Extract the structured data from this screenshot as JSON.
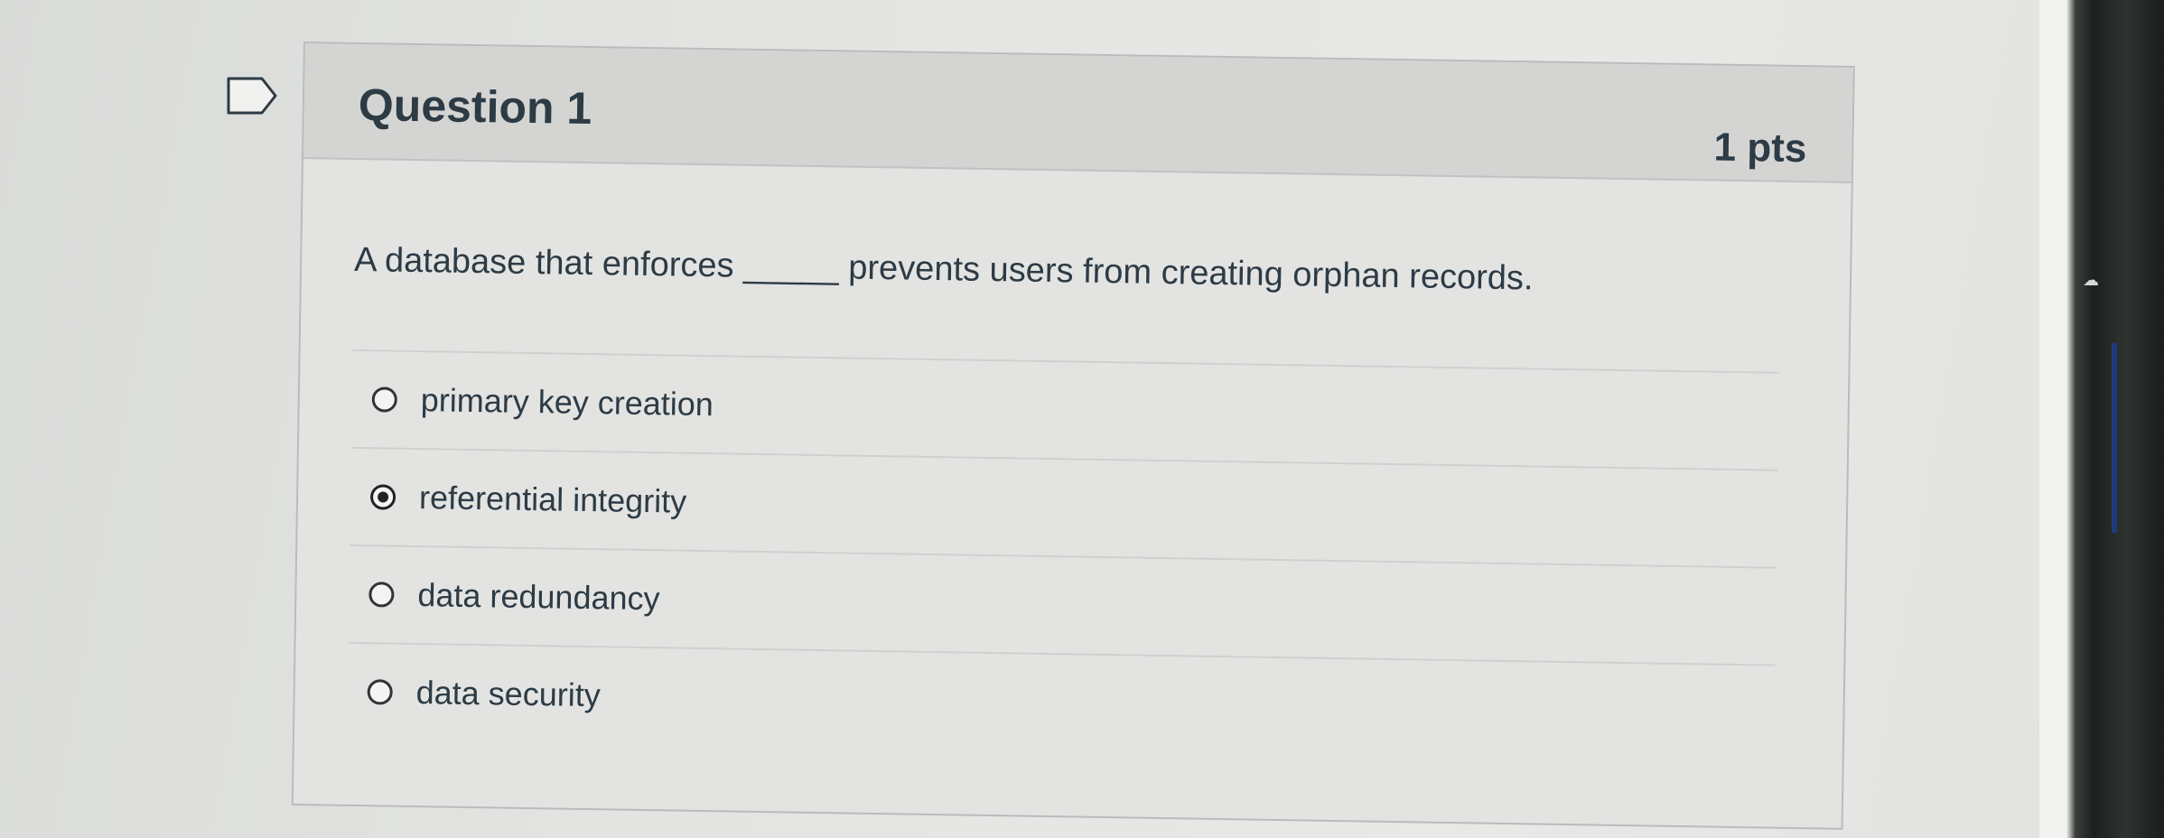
{
  "question": {
    "title": "Question 1",
    "points": "1 pts",
    "text": "A database that enforces _____ prevents users from creating orphan records."
  },
  "answers": [
    {
      "label": "primary key creation",
      "selected": false
    },
    {
      "label": "referential integrity",
      "selected": true
    },
    {
      "label": "data redundancy",
      "selected": false
    },
    {
      "label": "data security",
      "selected": false
    }
  ],
  "icons": {
    "flag": "bookmark-flag-icon"
  }
}
